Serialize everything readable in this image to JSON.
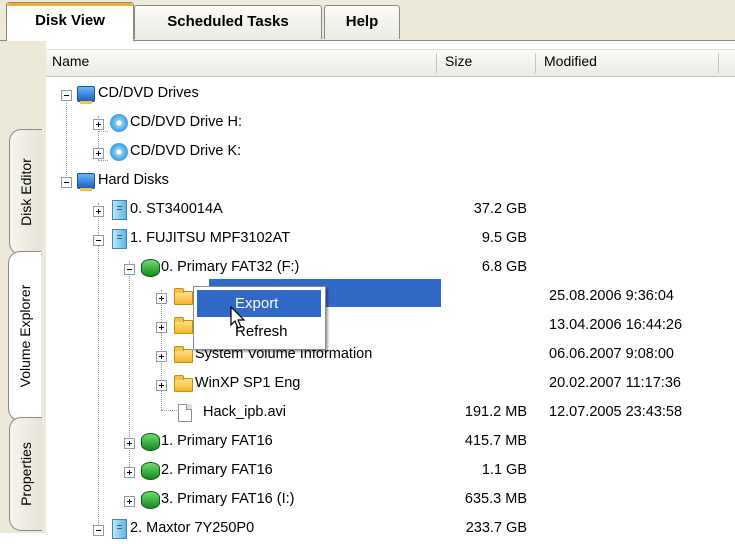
{
  "tabs": [
    {
      "label": "Disk View",
      "active": true
    },
    {
      "label": "Scheduled Tasks",
      "active": false
    },
    {
      "label": "Help",
      "active": false
    }
  ],
  "side_tabs": [
    {
      "label": "Disk Editor",
      "active": false
    },
    {
      "label": "Volume Explorer",
      "active": true
    },
    {
      "label": "Properties",
      "active": false
    }
  ],
  "columns": {
    "name": "Name",
    "size": "Size",
    "modified": "Modified"
  },
  "tree": [
    {
      "label": "CD/DVD Drives",
      "size": "",
      "modified": "",
      "icon": "computer-icon",
      "expander": "minus"
    },
    {
      "label": "CD/DVD Drive H:",
      "size": "",
      "modified": "",
      "icon": "cd-drive-icon",
      "expander": "plus"
    },
    {
      "label": "CD/DVD Drive K:",
      "size": "",
      "modified": "",
      "icon": "cd-drive-icon",
      "expander": "plus"
    },
    {
      "label": "Hard Disks",
      "size": "",
      "modified": "",
      "icon": "computer-icon",
      "expander": "minus"
    },
    {
      "label": "0. ST340014A",
      "size": "37.2 GB",
      "modified": "",
      "icon": "hard-disk-icon",
      "expander": "plus"
    },
    {
      "label": "1. FUJITSU MPF3102AT",
      "size": "9.5 GB",
      "modified": "",
      "icon": "hard-disk-icon",
      "expander": "minus"
    },
    {
      "label": "0. Primary FAT32 (F:)",
      "size": "6.8 GB",
      "modified": "",
      "icon": "partition-icon",
      "expander": "minus"
    },
    {
      "label": "",
      "size": "",
      "modified": "25.08.2006 9:36:04",
      "icon": "folder-icon",
      "expander": "plus",
      "selected": true
    },
    {
      "label": "",
      "size": "",
      "modified": "13.04.2006 16:44:26",
      "icon": "folder-icon",
      "expander": "plus"
    },
    {
      "label": "System Volume Information",
      "size": "",
      "modified": "06.06.2007 9:08:00",
      "icon": "folder-icon",
      "expander": "plus"
    },
    {
      "label": "WinXP SP1 Eng",
      "size": "",
      "modified": "20.02.2007 11:17:36",
      "icon": "folder-icon",
      "expander": "plus"
    },
    {
      "label": "Hack_ipb.avi",
      "size": "191.2 MB",
      "modified": "12.07.2005 23:43:58",
      "icon": "file-icon",
      "expander": "none"
    },
    {
      "label": "1. Primary FAT16",
      "size": "415.7 MB",
      "modified": "",
      "icon": "partition-icon",
      "expander": "plus"
    },
    {
      "label": "2. Primary FAT16",
      "size": "1.1 GB",
      "modified": "",
      "icon": "partition-icon",
      "expander": "plus"
    },
    {
      "label": "3. Primary FAT16 (I:)",
      "size": "635.3 MB",
      "modified": "",
      "icon": "partition-icon",
      "expander": "plus"
    },
    {
      "label": "2. Maxtor 7Y250P0",
      "size": "233.7 GB",
      "modified": "",
      "icon": "hard-disk-icon",
      "expander": "minus"
    }
  ],
  "context_menu": {
    "export": "Export",
    "refresh": "Refresh"
  }
}
